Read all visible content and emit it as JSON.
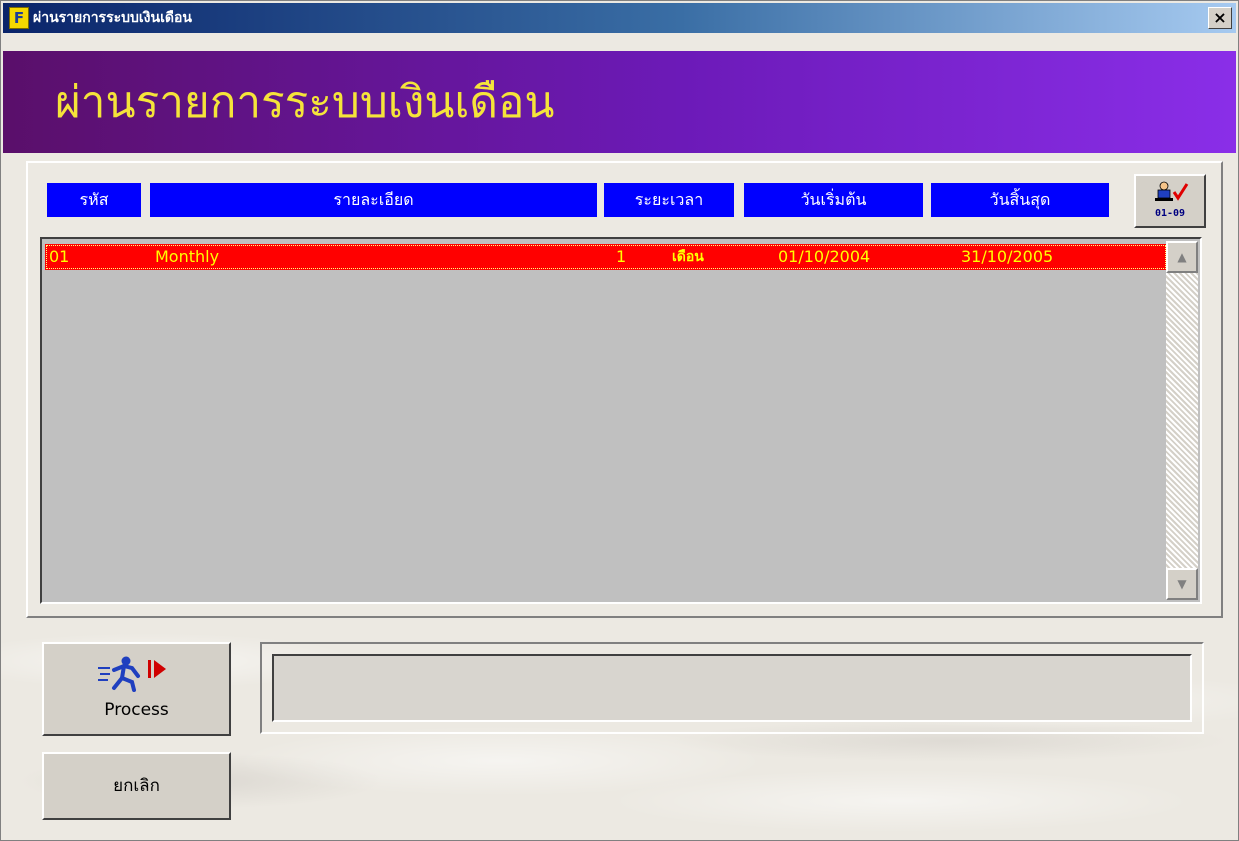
{
  "window": {
    "title": "ผ่านรายการระบบเงินเดือน",
    "close_label": "×"
  },
  "banner": {
    "title": "ผ่านรายการระบบเงินเดือน"
  },
  "columns": {
    "code": "รหัส",
    "description": "รายละเอียด",
    "period": "ระยะเวลา",
    "start_date": "วันเริ่มต้น",
    "end_date": "วันสิ้นสุด"
  },
  "tool_button": {
    "label": "01-09",
    "icon": "user-check-icon"
  },
  "rows": [
    {
      "code": "01",
      "description": "Monthly",
      "period_value": "1",
      "period_unit": "เดือน",
      "start_date": "01/10/2004",
      "end_date": "31/10/2005"
    }
  ],
  "buttons": {
    "process_label": "Process",
    "process_icon": "running-man-icon",
    "cancel_label": "ยกเลิก"
  },
  "status": {
    "text": ""
  },
  "colors": {
    "header_blue": "#0000ff",
    "row_red": "#ff0000",
    "row_text_yellow": "#ffff00",
    "banner_purple": "#6c1ab8",
    "banner_text": "#f5e43a"
  }
}
